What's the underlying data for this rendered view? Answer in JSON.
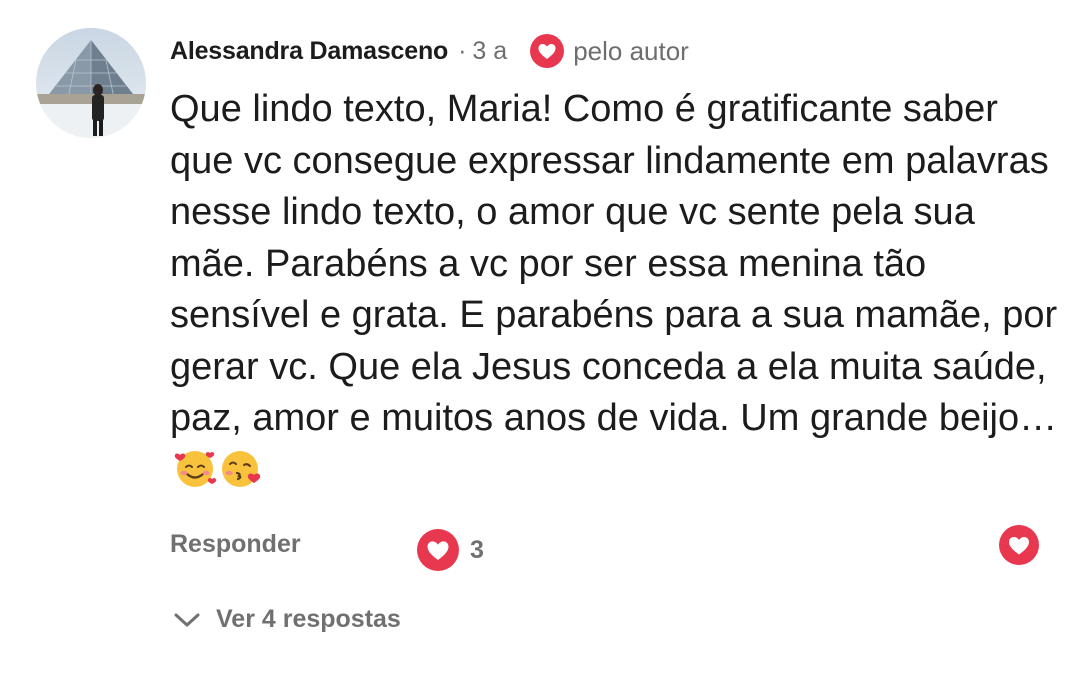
{
  "comment": {
    "author": "Alessandra Damasceno",
    "separator": "·",
    "time": "3 a",
    "liked_by_author_label": "pelo autor",
    "text": "Que lindo texto, Maria! Como é gratificante saber que vc consegue expressar lindamente em palavras nesse lindo texto, o amor que vc sente pela sua mãe. Parabéns a vc por ser essa menina tão sensível e grata. E parabéns para a sua mamãe, por gerar vc. Que ela Jesus conceda a ela muita saúde, paz, amor e muitos anos de vida. Um grande beijo…",
    "emojis": [
      "smiling-face-with-hearts",
      "face-blowing-a-kiss"
    ]
  },
  "actions": {
    "reply_label": "Responder",
    "like_count": "3"
  },
  "replies": {
    "label": "Ver 4 respostas"
  },
  "colors": {
    "heart_red": "#e8384f",
    "muted_text": "#707070",
    "body_text": "#1c1c1c"
  },
  "icons": {
    "author_heart": "heart-icon",
    "like": "heart-icon",
    "chevron": "chevron-down-icon"
  }
}
